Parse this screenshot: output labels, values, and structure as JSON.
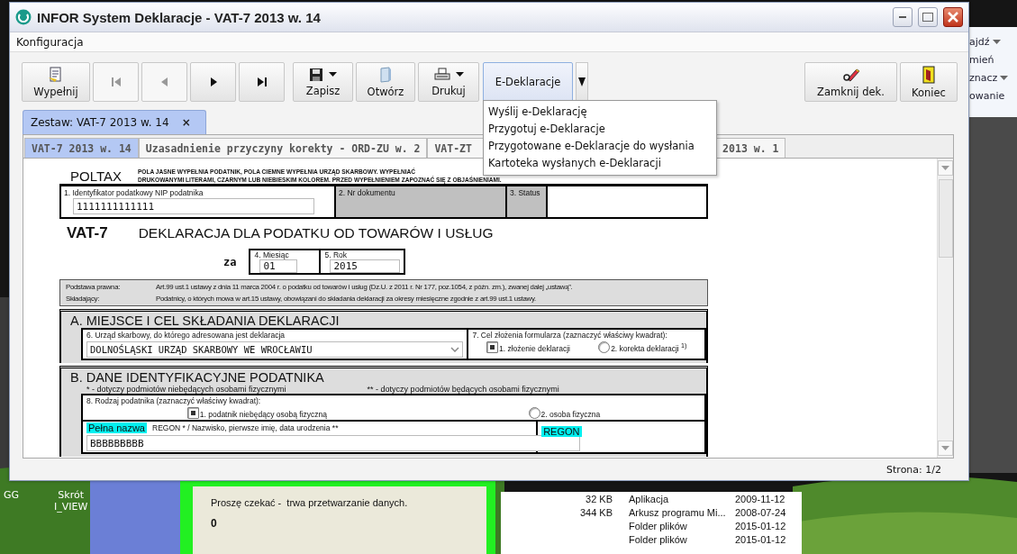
{
  "window": {
    "title": "INFOR System Deklaracje - VAT-7 2013 w. 14"
  },
  "menu": [
    "Konfiguracja"
  ],
  "toolbar": [
    {
      "kind": "fill",
      "label": "Wypełnij",
      "disabled": false,
      "dropdown": false
    },
    {
      "kind": "first",
      "disabled": true,
      "dropdown": false
    },
    {
      "kind": "prev",
      "disabled": true,
      "dropdown": false
    },
    {
      "kind": "next",
      "disabled": false,
      "dropdown": false
    },
    {
      "kind": "last",
      "disabled": false,
      "dropdown": false
    },
    {
      "kind": "save",
      "label": "Zapisz",
      "disabled": false,
      "dropdown": true
    },
    {
      "kind": "open",
      "label": "Otwórz",
      "disabled": false,
      "dropdown": false
    },
    {
      "kind": "print",
      "label": "Drukuj",
      "disabled": false,
      "dropdown": true
    },
    {
      "kind": "split",
      "label": "E-Deklaracje",
      "disabled": false,
      "dropdown": false,
      "expanded": true
    }
  ],
  "toolbar_right": [
    {
      "kind": "close-doc",
      "label": "Zamknij dek.",
      "disabled": false,
      "dropdown": false
    },
    {
      "kind": "exit",
      "label": "Koniec",
      "disabled": false,
      "dropdown": false
    }
  ],
  "dropdown_menu": {
    "items": [
      "Wyślij e-Deklarację",
      "Przygotuj e-Deklaracje",
      "Przygotowane e-Deklaracje do wysłania",
      "Kartoteka wysłanych e-Deklaracji"
    ]
  },
  "set_tab": {
    "label": "Zestaw: VAT-7 2013 w. 14",
    "close": "×"
  },
  "form_tabs": [
    {
      "label": "VAT-7 2013 w. 14",
      "selected": true
    },
    {
      "label": "Uzasadnienie przyczyny korekty - ORD-ZU w. 2",
      "selected": false
    },
    {
      "label": "VAT-ZT",
      "selected": false
    },
    {
      "label": "2013 w. 1",
      "selected": false
    }
  ],
  "form": {
    "brand": "POLTAX",
    "notes": [
      "POLA JASNE WYPEŁNIA PODATNIK, POLA CIEMNE WYPEŁNIA URZĄD SKARBOWY. WYPEŁNIAĆ",
      "DRUKOWANYMI LITERAMI, CZARNYM LUB NIEBIESKIM KOLOREM. PRZED WYPEŁNIENIEM ZAPOZNAĆ SIĘ Z OBJAŚNIENIAMI."
    ],
    "id_fields": [
      {
        "label": "1. Identyfikator podatkowy NIP podatnika",
        "value": "1111111111111",
        "kind": "input"
      },
      {
        "label": "2. Nr dokumentu",
        "kind": "office"
      },
      {
        "label": "3. Status",
        "kind": "office"
      }
    ],
    "code": "VAT-7",
    "title": "DEKLARACJA DLA PODATKU OD TOWARÓW I USŁUG",
    "period_prefix": "za",
    "period": [
      {
        "label": "4. Miesiąc",
        "value": "01"
      },
      {
        "label": "5. Rok",
        "value": "2015"
      }
    ],
    "legal": [
      {
        "label": "Podstawa prawna:",
        "text": "Art.99 ust.1 ustawy z dnia 11 marca 2004 r. o podatku od towarów i usług (Dz.U. z 2011 r. Nr 177, poz.1054, z późn. zm.), zwanej dalej „ustawą”."
      },
      {
        "label": "Składający:",
        "text": "Podatnicy, o których mowa w art.15 ustawy, obowiązani do składania deklaracji za okresy miesięczne zgodnie z art.99 ust.1 ustawy."
      }
    ],
    "section_a": {
      "heading": "A. MIEJSCE I CEL SKŁADANIA DEKLARACJI",
      "office": {
        "label": "6. Urząd skarbowy, do którego adresowana jest deklaracja",
        "value": "DOLNOŚLĄSKI URZĄD SKARBOWY WE WROCŁAWIU"
      },
      "purpose": {
        "label": "7. Cel złożenia formularza (zaznaczyć właściwy kwadrat):",
        "options": [
          {
            "label": "1. złożenie deklaracji",
            "selected": true
          },
          {
            "label": "2. korekta deklaracji $^{1)}$",
            "selected": false
          }
        ]
      }
    },
    "section_b": {
      "heading": "B. DANE IDENTYFIKACYJNE PODATNIKA",
      "notes": [
        "* - dotyczy podmiotów niebędących osobami fizycznymi",
        "** - dotyczy podmiotów będących osobami fizycznymi"
      ],
      "type": {
        "label": "8. Rodzaj podatnika (zaznaczyć właściwy kwadrat):",
        "options": [
          {
            "label": "1. podatnik niebędący osobą fizyczną",
            "selected": true
          },
          {
            "label": "2. osoba fizyczna",
            "selected": false
          }
        ]
      },
      "name": {
        "tag": "Pełna nazwa",
        "label": "REGON * / Nazwisko, pierwsze imię, data urodzenia **",
        "value": "BBBBBBBBB",
        "regon_tag": "REGON"
      }
    }
  },
  "status_bar": "Strona: 1/2",
  "background": {
    "side_panel": [
      {
        "label": "ajdź",
        "dropdown": true
      },
      {
        "label": "mień",
        "dropdown": false
      },
      {
        "label": "znacz",
        "dropdown": true
      },
      {
        "label": "owanie",
        "dropdown": false
      }
    ],
    "desktop_icons": [
      {
        "lines": [
          "GG"
        ]
      },
      {
        "lines": [
          "Skrót",
          "I_VIEW"
        ]
      }
    ],
    "busy_dialog": {
      "message": "Proszę czekać -  trwa przetwarzanie danych.",
      "count": "0"
    },
    "file_rows": [
      {
        "size": "32 KB",
        "type": "Aplikacja",
        "date": "2009-11-12"
      },
      {
        "size": "344 KB",
        "type": "Arkusz programu Mi...",
        "date": "2008-07-24"
      },
      {
        "type": "Folder plików",
        "date": "2015-01-12"
      },
      {
        "type": "Folder plików",
        "date": "2015-01-12"
      }
    ]
  }
}
